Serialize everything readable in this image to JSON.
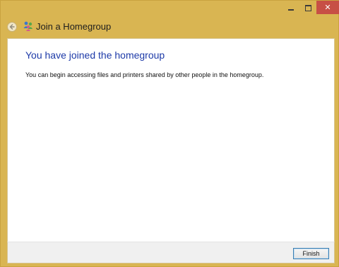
{
  "window": {
    "title": "Join a Homegroup",
    "accent_color": "#d9b552",
    "controls": {
      "minimize_icon": "minimize-icon",
      "maximize_icon": "maximize-icon",
      "close_icon": "close-icon",
      "close_color": "#c74f45"
    }
  },
  "nav": {
    "back_icon": "back-arrow-icon",
    "app_icon": "homegroup-icon"
  },
  "main": {
    "heading": "You have joined the homegroup",
    "heading_color": "#1d3aa8",
    "description": "You can begin accessing files and printers shared by other people in the homegroup."
  },
  "footer": {
    "finish_label": "Finish"
  }
}
